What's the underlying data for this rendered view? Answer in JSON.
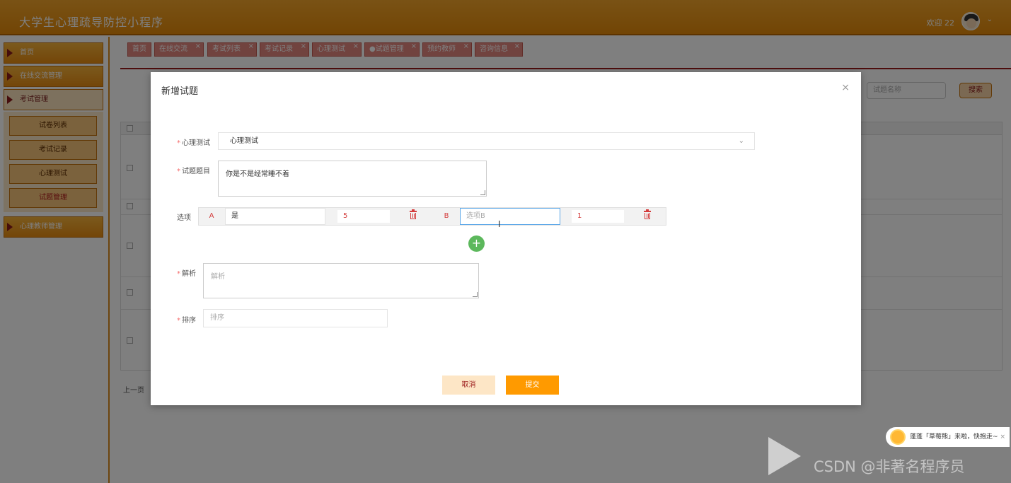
{
  "app": {
    "title": "大学生心理疏导防控小程序",
    "welcome": "欢迎 22"
  },
  "sidebar": {
    "items": [
      {
        "label": "首页"
      },
      {
        "label": "在线交流管理"
      },
      {
        "label": "考试管理"
      },
      {
        "label": "心理教师管理"
      }
    ],
    "sub_items": [
      {
        "label": "试卷列表"
      },
      {
        "label": "考试记录"
      },
      {
        "label": "心理测试"
      },
      {
        "label": "试题管理"
      }
    ]
  },
  "tabs": [
    {
      "label": "首页"
    },
    {
      "label": "在线交流"
    },
    {
      "label": "考试列表"
    },
    {
      "label": "考试记录"
    },
    {
      "label": "心理测试"
    },
    {
      "label": "●试题管理"
    },
    {
      "label": "预约教师"
    },
    {
      "label": "咨询信息"
    }
  ],
  "search": {
    "placeholder": "试题名称",
    "button": "搜索"
  },
  "pagination": {
    "prev": "上一页"
  },
  "modal": {
    "title": "新增试题",
    "close": "×",
    "fields": {
      "test_label": "心理测试",
      "test_value": "心理测试",
      "question_label": "试题题目",
      "question_value": "你是不是经常睡不着",
      "options_label": "选项",
      "analysis_label": "解析",
      "analysis_placeholder": "解析",
      "sort_label": "排序",
      "sort_placeholder": "排序"
    },
    "options": [
      {
        "letter": "A",
        "text": "是",
        "score": "5"
      },
      {
        "letter": "B",
        "text": "选项B",
        "score": "1"
      }
    ],
    "add": "+",
    "cancel": "取消",
    "submit": "提交"
  },
  "overlay": {
    "notice": "蓬蓬「草莓熊」来啦，快抱走~",
    "watermark": "CSDN @非著名程序员"
  }
}
